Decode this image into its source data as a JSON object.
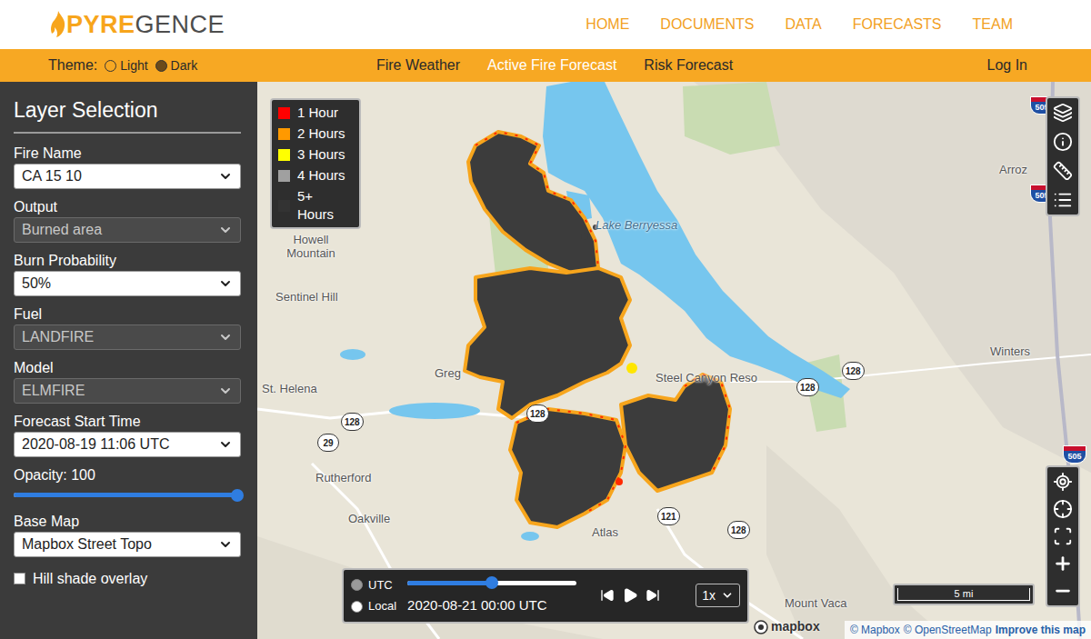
{
  "header": {
    "logo": {
      "brand_a": "PYRE",
      "brand_b": "GENCE"
    },
    "nav": [
      {
        "label": "HOME"
      },
      {
        "label": "DOCUMENTS"
      },
      {
        "label": "DATA"
      },
      {
        "label": "FORECASTS"
      },
      {
        "label": "TEAM"
      }
    ]
  },
  "subnav": {
    "theme_label": "Theme:",
    "themes": [
      {
        "label": "Light",
        "selected": false
      },
      {
        "label": "Dark",
        "selected": true
      }
    ],
    "tabs": [
      {
        "label": "Fire Weather",
        "selected": false
      },
      {
        "label": "Active Fire Forecast",
        "selected": true
      },
      {
        "label": "Risk Forecast",
        "selected": false
      }
    ],
    "login": "Log In"
  },
  "sidebar": {
    "title": "Layer Selection",
    "fields": [
      {
        "kind": "select",
        "label": "Fire Name",
        "value": "CA 15 10",
        "disabled": false
      },
      {
        "kind": "select",
        "label": "Output",
        "value": "Burned area",
        "disabled": true
      },
      {
        "kind": "select",
        "label": "Burn Probability",
        "value": "50%",
        "disabled": false
      },
      {
        "kind": "select",
        "label": "Fuel",
        "value": "LANDFIRE",
        "disabled": true
      },
      {
        "kind": "select",
        "label": "Model",
        "value": "ELMFIRE",
        "disabled": true
      },
      {
        "kind": "select",
        "label": "Forecast Start Time",
        "value": "2020-08-19 11:06 UTC",
        "disabled": false
      },
      {
        "kind": "slider",
        "label": "Opacity: 100",
        "level": 1
      },
      {
        "kind": "select",
        "label": "Base Map",
        "value": "Mapbox Street Topo",
        "disabled": false
      }
    ],
    "hill_shade": {
      "label": "Hill shade overlay",
      "checked": false
    }
  },
  "legend": [
    {
      "label": "1 Hour",
      "color": "#ff0000"
    },
    {
      "label": "2 Hours",
      "color": "#ff9900"
    },
    {
      "label": "3 Hours",
      "color": "#ffff00"
    },
    {
      "label": "4 Hours",
      "color": "#a0a0a0"
    },
    {
      "label": "5+ Hours",
      "color": "#333333"
    }
  ],
  "map": {
    "places": [
      {
        "label": "Howell Mountain"
      },
      {
        "label": "Sentinel Hill"
      },
      {
        "label": "Lake Berryessa"
      },
      {
        "label": "Greg"
      },
      {
        "label": "Steel Canyon Reso"
      },
      {
        "label": "St. Helena"
      },
      {
        "label": "Rutherford"
      },
      {
        "label": "Oakville"
      },
      {
        "label": "Atlas"
      },
      {
        "label": "Arroz"
      },
      {
        "label": "Winters"
      },
      {
        "label": "Mount Vaca"
      }
    ],
    "shields": [
      {
        "label": "128",
        "kind": "state"
      },
      {
        "label": "29",
        "kind": "state"
      },
      {
        "label": "128",
        "kind": "state"
      },
      {
        "label": "121",
        "kind": "state"
      },
      {
        "label": "128",
        "kind": "state"
      },
      {
        "label": "128",
        "kind": "state"
      },
      {
        "label": "128",
        "kind": "state"
      },
      {
        "label": "505",
        "kind": "interstate"
      },
      {
        "label": "505",
        "kind": "interstate"
      },
      {
        "label": "505",
        "kind": "interstate"
      }
    ]
  },
  "time_control": {
    "modes": [
      {
        "label": "UTC",
        "selected": true
      },
      {
        "label": "Local",
        "selected": false
      }
    ],
    "level": 0.5,
    "time": "2020-08-21 00:00 UTC",
    "speed": "1x"
  },
  "scale": "5 mi",
  "attribution": {
    "logo": "mapbox",
    "links": [
      "© Mapbox",
      "© OpenStreetMap",
      "Improve this map"
    ]
  }
}
